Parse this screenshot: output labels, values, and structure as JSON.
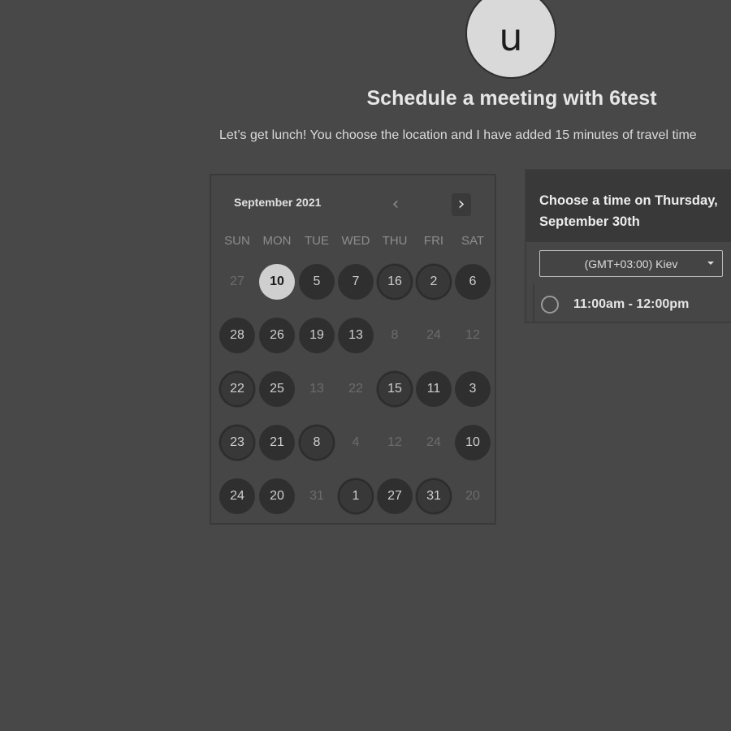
{
  "host": {
    "avatar_letter": "u",
    "title": "Schedule a meeting with 6test",
    "description": "Let’s get lunch! You choose the location and I have added 15 minutes of travel time"
  },
  "calendar": {
    "month_label": "September 2021",
    "prev_icon": "chevron-left-icon",
    "next_icon": "chevron-right-icon",
    "weekdays": [
      "SUN",
      "MON",
      "TUE",
      "WED",
      "THU",
      "FRI",
      "SAT"
    ],
    "weeks": [
      [
        {
          "label": "27",
          "state": "off"
        },
        {
          "label": "10",
          "state": "selected"
        },
        {
          "label": "5",
          "state": "avail"
        },
        {
          "label": "7",
          "state": "avail"
        },
        {
          "label": "16",
          "state": "rough"
        },
        {
          "label": "2",
          "state": "rough"
        },
        {
          "label": "6",
          "state": "avail"
        }
      ],
      [
        {
          "label": "28",
          "state": "avail"
        },
        {
          "label": "26",
          "state": "avail"
        },
        {
          "label": "19",
          "state": "avail"
        },
        {
          "label": "13",
          "state": "avail"
        },
        {
          "label": "8",
          "state": "off"
        },
        {
          "label": "24",
          "state": "off"
        },
        {
          "label": "12",
          "state": "off"
        }
      ],
      [
        {
          "label": "22",
          "state": "rough"
        },
        {
          "label": "25",
          "state": "avail"
        },
        {
          "label": "13",
          "state": "off"
        },
        {
          "label": "22",
          "state": "off"
        },
        {
          "label": "15",
          "state": "rough"
        },
        {
          "label": "11",
          "state": "avail"
        },
        {
          "label": "3",
          "state": "avail"
        }
      ],
      [
        {
          "label": "23",
          "state": "rough"
        },
        {
          "label": "21",
          "state": "avail"
        },
        {
          "label": "8",
          "state": "rough"
        },
        {
          "label": "4",
          "state": "off"
        },
        {
          "label": "12",
          "state": "off"
        },
        {
          "label": "24",
          "state": "off"
        },
        {
          "label": "10",
          "state": "avail"
        }
      ],
      [
        {
          "label": "24",
          "state": "avail"
        },
        {
          "label": "20",
          "state": "avail"
        },
        {
          "label": "31",
          "state": "off"
        },
        {
          "label": "1",
          "state": "rough"
        },
        {
          "label": "27",
          "state": "avail"
        },
        {
          "label": "31",
          "state": "rough"
        },
        {
          "label": "20",
          "state": "off"
        }
      ]
    ]
  },
  "times": {
    "heading": "Choose a time on Thursday, September 30th",
    "timezone": "(GMT+03:00) Kiev",
    "slots": [
      {
        "label": "11:00am - 12:00pm"
      }
    ]
  }
}
